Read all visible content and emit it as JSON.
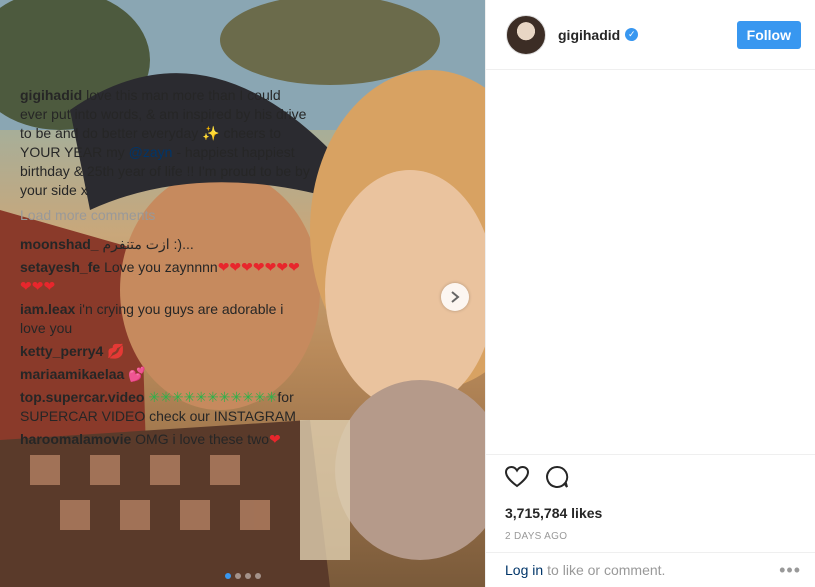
{
  "header": {
    "username": "gigihadid",
    "follow_label": "Follow"
  },
  "caption": {
    "username": "gigihadid",
    "text_before_mention": "love this man more than I could ever put into words, & am inspired by his drive to be and do better everyday ✨ cheers to YOUR YEAR my",
    "mention": "@zayn",
    "text_after_mention": "- happiest happiest birthday & 25th year of life !! I'm proud to be by your side x"
  },
  "load_more_label": "Load more comments",
  "comments": [
    {
      "username": "moonshad_",
      "text": "ازت متنفرم :)..."
    },
    {
      "username": "setayesh_fe",
      "text": "Love you zaynnnn",
      "emoji": "❤❤❤❤❤❤❤❤❤❤"
    },
    {
      "username": "iam.leax",
      "text": "i'n crying you guys are adorable i love you"
    },
    {
      "username": "ketty_perry4",
      "emoji": "💋"
    },
    {
      "username": "mariaamikaelaa",
      "emoji": "💕"
    },
    {
      "username": "top.supercar.video",
      "emoji": "✳✳✳✳✳✳✳✳✳✳✳",
      "text": "for SUPERCAR VIDEO check our INSTAGRAM"
    },
    {
      "username": "haroomalamovie",
      "text": "OMG i love these two",
      "emoji": "❤"
    }
  ],
  "likes": "3,715,784 likes",
  "date": "2 DAYS AGO",
  "footer": {
    "login_label": "Log in",
    "login_suffix": "to like or comment.",
    "more_label": "•••"
  },
  "colors": {
    "accent": "#3897f0",
    "link": "#003569",
    "muted": "#999999"
  },
  "icons": [
    "chevron-right-icon",
    "verified-badge-icon",
    "heart-icon",
    "comment-icon",
    "more-options-icon"
  ],
  "carousel": {
    "slides": 4,
    "active_slide": 1
  }
}
